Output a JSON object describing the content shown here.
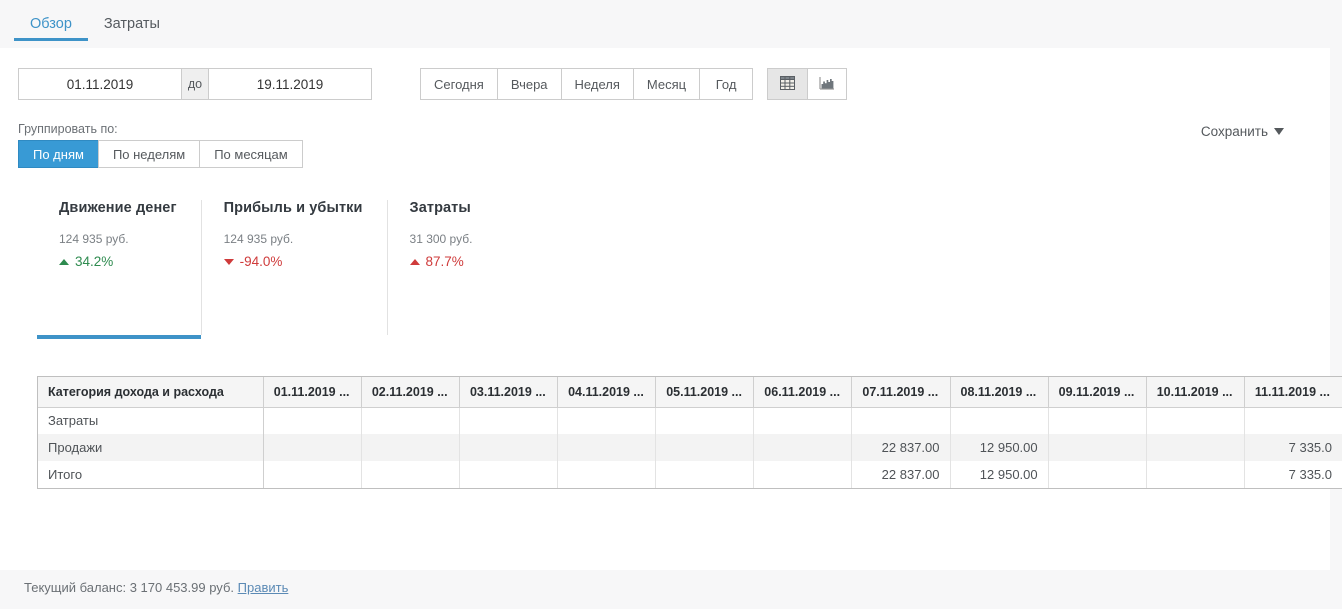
{
  "tabs": [
    {
      "label": "Обзор",
      "active": true
    },
    {
      "label": "Затраты",
      "active": false
    }
  ],
  "filters": {
    "date_from": "01.11.2019",
    "date_to": "19.11.2019",
    "date_separator": "до",
    "quick_ranges": [
      "Сегодня",
      "Вчера",
      "Неделя",
      "Месяц",
      "Год"
    ],
    "view_modes": [
      {
        "name": "table-view",
        "icon": "table-icon",
        "active": true
      },
      {
        "name": "chart-view",
        "icon": "area-chart-icon",
        "active": false
      }
    ],
    "save_label": "Сохранить"
  },
  "group_by": {
    "label": "Группировать по:",
    "options": [
      {
        "label": "По дням",
        "active": true
      },
      {
        "label": "По неделям",
        "active": false
      },
      {
        "label": "По месяцам",
        "active": false
      }
    ]
  },
  "kpi_cards": [
    {
      "title": "Движение денег",
      "amount": "124 935 руб.",
      "delta": "34.2%",
      "direction": "up",
      "tone": "positive",
      "selected": true
    },
    {
      "title": "Прибыль и убытки",
      "amount": "124 935 руб.",
      "delta": "-94.0%",
      "direction": "down",
      "tone": "negative",
      "selected": false
    },
    {
      "title": "Затраты",
      "amount": "31 300 руб.",
      "delta": "87.7%",
      "direction": "up",
      "tone": "negative",
      "selected": false
    }
  ],
  "table": {
    "columns": [
      "Категория дохода и расхода",
      "01.11.2019 ...",
      "02.11.2019 ...",
      "03.11.2019 ...",
      "04.11.2019 ...",
      "05.11.2019 ...",
      "06.11.2019 ...",
      "07.11.2019 ...",
      "08.11.2019 ...",
      "09.11.2019 ...",
      "10.11.2019 ...",
      "11.11.2019 ..."
    ],
    "rows": [
      {
        "category": "Затраты",
        "values": [
          "",
          "",
          "",
          "",
          "",
          "",
          "",
          "",
          "",
          "",
          ""
        ]
      },
      {
        "category": "Продажи",
        "values": [
          "",
          "",
          "",
          "",
          "",
          "",
          "22 837.00",
          "12 950.00",
          "",
          "",
          "7 335.0"
        ]
      },
      {
        "category": "Итого",
        "values": [
          "",
          "",
          "",
          "",
          "",
          "",
          "22 837.00",
          "12 950.00",
          "",
          "",
          "7 335.0"
        ]
      }
    ]
  },
  "footer": {
    "balance_text": "Текущий баланс: 3 170 453.99 руб.",
    "edit_link": "Править"
  },
  "colors": {
    "accent": "#3e93c8",
    "active_group": "#389ad5",
    "positive": "#2e8b4f",
    "negative": "#cf3b3b",
    "number": "#4a8fc4",
    "page_bg": "#f7f7f8"
  }
}
